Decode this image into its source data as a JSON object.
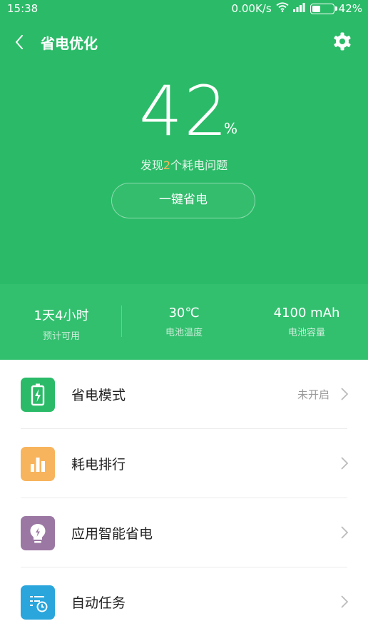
{
  "status_bar": {
    "time": "15:38",
    "network_speed": "0.00K/s",
    "battery_text": "42%",
    "battery_level": 0.42,
    "wifi_icon": "wifi-icon",
    "signal_icon": "signal-icon",
    "battery_icon": "battery-icon"
  },
  "header": {
    "title": "省电优化",
    "back_icon": "back-icon",
    "settings_icon": "gear-icon"
  },
  "battery": {
    "percent": "42",
    "unit": "%",
    "issues_prefix": "发现",
    "issues_count": "2",
    "issues_suffix": "个耗电问题",
    "optimize_button": "一键省电"
  },
  "stats": [
    {
      "value": "1天4小时",
      "label": "预计可用"
    },
    {
      "value": "30℃",
      "label": "电池温度"
    },
    {
      "value": "4100 mAh",
      "label": "电池容量"
    }
  ],
  "menu": [
    {
      "label": "省电模式",
      "value": "未开启",
      "icon": "battery-mode-icon",
      "color": "#2bbb68"
    },
    {
      "label": "耗电排行",
      "value": "",
      "icon": "bar-chart-icon",
      "color": "#f8b45c"
    },
    {
      "label": "应用智能省电",
      "value": "",
      "icon": "lightbulb-icon",
      "color": "#9b78a3"
    },
    {
      "label": "自动任务",
      "value": "",
      "icon": "scheduled-task-icon",
      "color": "#2aa6dc"
    }
  ],
  "colors": {
    "accent": "#2bbb68",
    "highlight": "#f7b95a"
  }
}
